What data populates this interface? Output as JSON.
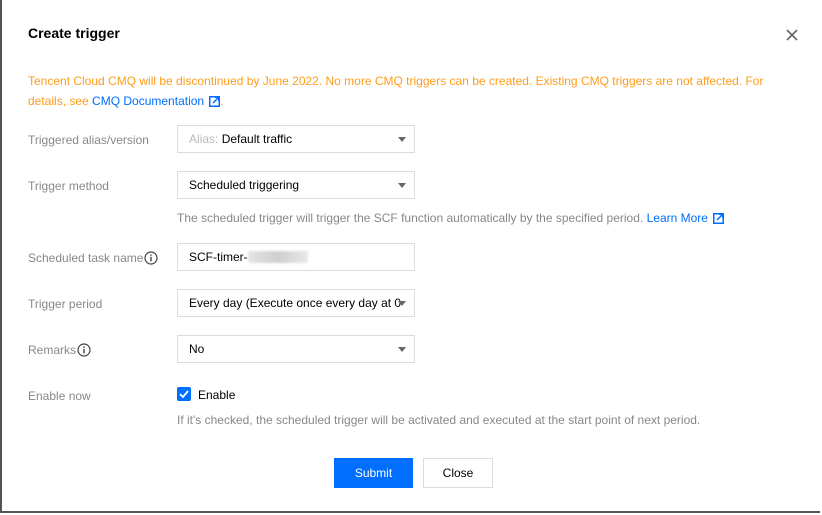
{
  "dialog": {
    "title": "Create trigger",
    "close_icon": "close-icon"
  },
  "notice": {
    "text": "Tencent Cloud CMQ will be discontinued by June 2022. No more CMQ triggers can be created. Existing CMQ triggers are not affected. For details, see ",
    "link_text": "CMQ Documentation",
    "tail": ".",
    "color": "#ff9c19"
  },
  "form": {
    "alias_version": {
      "label": "Triggered alias/version",
      "prefix": "Alias:",
      "value": "Default traffic"
    },
    "trigger_method": {
      "label": "Trigger method",
      "value": "Scheduled triggering",
      "hint": "The scheduled trigger will trigger the SCF function automatically by the specified period.",
      "hint_link": "Learn More"
    },
    "task_name": {
      "label": "Scheduled task name",
      "value": "SCF-timer-"
    },
    "trigger_period": {
      "label": "Trigger period",
      "value": "Every day (Execute once every day at 0("
    },
    "remarks": {
      "label": "Remarks",
      "value": "No"
    },
    "enable_now": {
      "label": "Enable now",
      "checkbox_label": "Enable",
      "checked": true,
      "hint": "If it's checked, the scheduled trigger will be activated and executed at the start point of next period."
    }
  },
  "buttons": {
    "submit": "Submit",
    "close": "Close"
  },
  "colors": {
    "accent": "#006eff",
    "warning": "#ff9c19"
  }
}
